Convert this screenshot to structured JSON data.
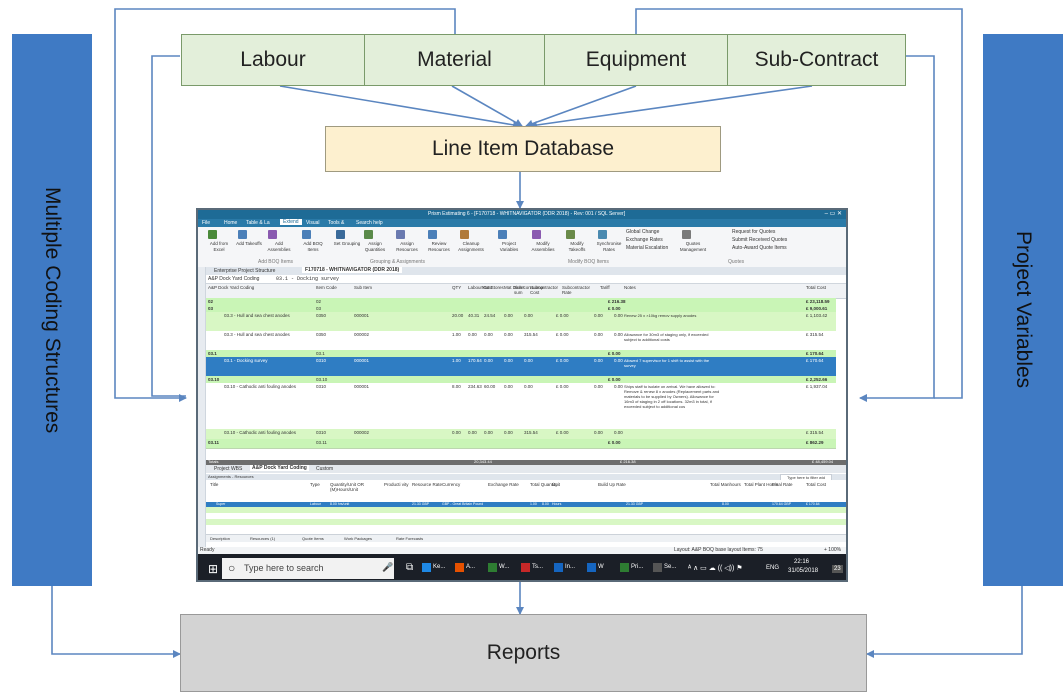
{
  "cost_types": [
    "Labour",
    "Material",
    "Equipment",
    "Sub-Contract"
  ],
  "database": "Line Item Database",
  "left_panel": "Multiple Coding Structures",
  "right_panel": "Project Variables",
  "output": "Reports",
  "screenshot": {
    "title": "Prism Estimating 6 - [F170718 - WHITNAVIGATOR (DDR 2018) - Rev: 001 / SQL Server]",
    "ribbon_tabs": [
      "File",
      "Home",
      "Table & La",
      "Extend",
      "Visual",
      "Tools & ",
      "Search help"
    ],
    "ribbon_buttons": [
      "Add from Excel",
      "Add Takeoffs",
      "Add Assemblies",
      "Add BOQ Items",
      "Set Grouping",
      "Assign Quantities",
      "Assign Resources",
      "Review Resources",
      "Cleanup Assignments",
      "Project Variables",
      "Modify Assemblies",
      "Modify Takeoffs",
      "Synchronise Rates",
      "Quotes Management"
    ],
    "ribbon_side_items": [
      "Global Change",
      "Exchange Rates",
      "Material Escalation",
      "Request for Quotes",
      "Submit Received Quotes",
      "Auto-Award Quote Items"
    ],
    "ribbon_groups": [
      "Add BOQ Items",
      "Grouping & Assignments",
      "Modify BOQ Items",
      "Quotes"
    ],
    "doc_tabs": [
      "Enterprise Project Structure",
      "F170718 - WHITNAVIGATOR (DDR 2018)"
    ],
    "coding_label": "A&P Dock Yard Coding",
    "formula_text": "03.1 - Docking survey",
    "grid_headers": [
      "A&P Dock Yard Coding",
      "Item Code",
      "Sub Item",
      "QTY",
      "Labour Cost",
      "Mat Stores",
      "Mat Direct",
      "Sub-con Lump sum",
      "Subcontractor Cost",
      "Subcontractor Rate",
      "Tariff",
      "Notes",
      "Total Cost"
    ],
    "grid_rows": [
      {
        "code": "02",
        "item": "02",
        "total": "£ 23,118.59",
        "sub": "£ 216.38"
      },
      {
        "code": "03",
        "item": "03",
        "total": "£ 9,000.61",
        "sub": "£ 0.00"
      },
      {
        "code": "03.3 - Hull and sea chest anodes",
        "item": "0350",
        "subitem": "000001",
        "qty": "20.00",
        "labour": "40.31",
        "stores": "24.54",
        "direct": "0.00",
        "lump": "0.00",
        "subcost": "£ 0.00",
        "rate": "0.00",
        "tariff": "0.00",
        "notes": "Renew 25 x ×10kg remov supply anodes",
        "total": "£ 1,103.42"
      },
      {
        "code": "03.3 - Hull and sea chest anodes",
        "item": "0350",
        "subitem": "000002",
        "qty": "1.00",
        "labour": "0.00",
        "stores": "0.00",
        "direct": "0.00",
        "lump": "315.54",
        "subcost": "£ 0.00",
        "rate": "0.00",
        "tariff": "0.00",
        "notes": "Allowance for 30m3 of staging only, if exceeded subject to additional costs",
        "total": "£ 315.54"
      },
      {
        "code": "03.1",
        "item": "03.1",
        "total": "£ 170.64",
        "sub": "£ 0.00"
      },
      {
        "code": "03.1 - Docking survey",
        "item": "0310",
        "subitem": "000001",
        "qty": "1.00",
        "labour": "170.64",
        "stores": "0.00",
        "direct": "0.00",
        "lump": "0.00",
        "subcost": "£ 0.00",
        "rate": "0.00",
        "tariff": "0.00",
        "notes": "Allowed 7 supervisor for 1 shift to assist with the survey",
        "total": "£ 170.64"
      },
      {
        "code": "03.10",
        "item": "03.10",
        "total": "£ 2,252.66",
        "sub": "£ 0.00"
      },
      {
        "code": "03.10 - Cathodic anti fouling anodes",
        "item": "0310",
        "subitem": "000001",
        "qty": "8.00",
        "labour": "234.63",
        "stores": "60.00",
        "direct": "0.00",
        "lump": "0.00",
        "subcost": "£ 0.00",
        "rate": "0.00",
        "tariff": "0.00",
        "notes": "Ships staff to isolate on arrival. We have allowed to: Remove & renew 8 x anodes (Replacement parts and materials to be supplied by Owners). Allowance for 16m3 of staging in 2 off locations. 32m3 in total, if exceeded subject to additional cos",
        "total": "£ 1,937.04"
      },
      {
        "code": "03.10 - Cathodic anti fouling anodes",
        "item": "0310",
        "subitem": "000002",
        "qty": "0.00",
        "labour": "0.00",
        "stores": "0.00",
        "direct": "0.00",
        "lump": "315.54",
        "subcost": "£ 0.00",
        "rate": "0.00",
        "tariff": "0.00",
        "notes": "",
        "total": "£ 315.54"
      },
      {
        "code": "03.11",
        "item": "03.11",
        "total": "£ 862.29",
        "sub": "£ 0.00"
      }
    ],
    "grid_totals": {
      "label": "Totals",
      "labour": "20,343.44",
      "sub": "£ 216.38",
      "total": "£ 48,459.04"
    },
    "bottom_tabs": [
      "Project WBS",
      "A&P Dock Yard Coding",
      "Custom"
    ],
    "lower_panel_title": "Assignments - Resources",
    "lower_headers": [
      "Title",
      "Type",
      "Quantity/Unit OR (M)Hours/Unit",
      "Producti vity",
      "Resource Rate",
      "Currency",
      "Exchange Rate",
      "Total Quantity",
      "Unit",
      "Build Up Rate",
      "Total Manhours",
      "Total Plant Hours",
      "Final Rate",
      "Total Cost"
    ],
    "lower_row": {
      "title": "Super",
      "type": "Labour",
      "qty": "8.00 hrs/unit",
      "rate": "21.33 GBP",
      "currency": "GBP - Great Britain Pound",
      "exch": "1.00",
      "total_qty": "8.00",
      "unit": "Hours",
      "build": "21.33 GBP",
      "manhours": "8.00",
      "final": "170.64 GBP",
      "cost": "£ 170.64"
    },
    "lower_tabs": [
      "Description",
      "Resources (1)",
      "Quote Items",
      "Work Packages",
      "Rate Forecasts"
    ],
    "status_left": "Ready",
    "status_right": "Layout: A&P BOQ base layout  Items: 75",
    "zoom": "+ 100%",
    "taskbar_search": "Type here to search",
    "taskbar_apps": [
      "Ke...",
      "A...",
      "W...",
      "Ts...",
      "In...",
      "W",
      "Pri...",
      "Se..."
    ],
    "lang": "ENG",
    "clock_time": "22:16",
    "clock_date": "31/05/2018",
    "notif_count": "23"
  }
}
